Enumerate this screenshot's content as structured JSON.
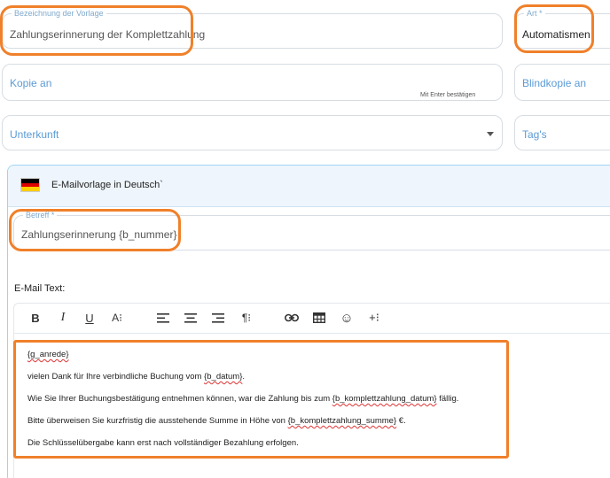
{
  "template_name": {
    "label": "Bezeichnung der Vorlage",
    "value": "Zahlungserinnerung der Komplettzahlung"
  },
  "art": {
    "label": "Art *",
    "value": "Automatismen"
  },
  "kopie_an": {
    "placeholder": "Kopie an",
    "hint": "Mit Enter bestätigen"
  },
  "blindkopie_an": {
    "placeholder": "Blindkopie an"
  },
  "unterkunft": {
    "placeholder": "Unterkunft"
  },
  "tags": {
    "placeholder": "Tag's"
  },
  "language_section": {
    "title": "E-Mailvorlage in Deutsch`",
    "flag_colors": [
      "#000000",
      "#dd0000",
      "#ffce00"
    ]
  },
  "betreff": {
    "label": "Betreff *",
    "value": "Zahlungserinnerung {b_nummer}"
  },
  "email_text_label": "E-Mail Text:",
  "toolbar": [
    "bold-icon",
    "italic-icon",
    "underline-icon",
    "font-size-icon",
    "align-left-icon",
    "align-center-icon",
    "align-right-icon",
    "paragraph-format-icon",
    "link-icon",
    "table-icon",
    "emoji-icon",
    "insert-more-icon"
  ],
  "toolbar_glyphs": {
    "bold": "B",
    "italic": "I",
    "underline": "U",
    "font_size": "A⁝",
    "paragraph": "¶⁝",
    "emoji": "☺",
    "more": "+⁝"
  },
  "body": {
    "line1": {
      "var": "{g_anrede}"
    },
    "line2": {
      "text": "vielen Dank für Ihre verbindliche Buchung vom ",
      "var": "{b_datum}",
      "end": "."
    },
    "line3": {
      "text": "Wie Sie Ihrer Buchungsbestätigung entnehmen können, war die Zahlung bis zum ",
      "var": "{b_komplettzahlung_datum}",
      "end": " fällig."
    },
    "line4": {
      "text": "Bitte überweisen Sie kurzfristig die ausstehende Summe in Höhe von ",
      "var": "{b_komplettzahlung_summe}",
      "end": " €."
    },
    "line5": {
      "text": "Die Schlüsselübergabe kann erst nach vollständiger Bezahlung erfolgen."
    }
  },
  "colors": {
    "highlight": "#f0802a",
    "label_blue": "#7fa9cc",
    "placeholder_blue": "#5b9bd5",
    "header_bg": "#eef5fc"
  }
}
